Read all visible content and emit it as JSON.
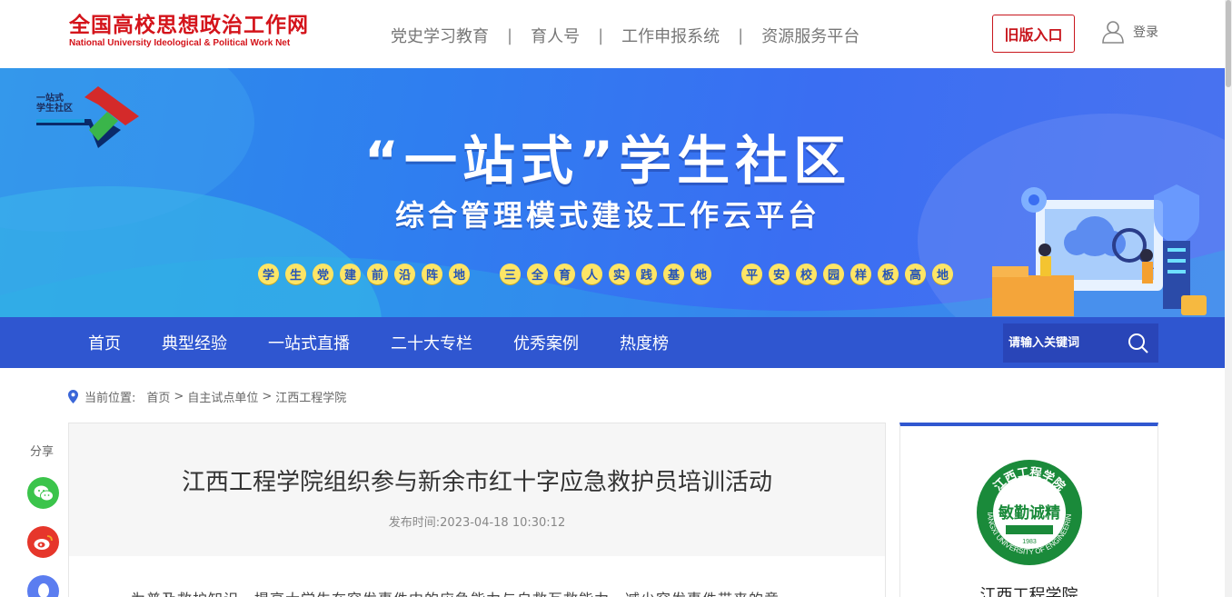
{
  "header": {
    "logo_cn": "全国高校思想政治工作网",
    "logo_en": "National University Ideological & Political Work Net",
    "nav": [
      "党史学习教育",
      "育人号",
      "工作申报系统",
      "资源服务平台"
    ],
    "nav_sep": "|",
    "old_entry": "旧版入口",
    "login": "登录"
  },
  "banner": {
    "logo_text_line1": "一站式",
    "logo_text_line2": "学生社区",
    "title": "“一站式”学生社区",
    "subtitle": "综合管理模式建设工作云平台",
    "groups": [
      [
        "学",
        "生",
        "党",
        "建",
        "前",
        "沿",
        "阵",
        "地"
      ],
      [
        "三",
        "全",
        "育",
        "人",
        "实",
        "践",
        "基",
        "地"
      ],
      [
        "平",
        "安",
        "校",
        "园",
        "样",
        "板",
        "高",
        "地"
      ]
    ]
  },
  "main_nav": {
    "items": [
      "首页",
      "典型经验",
      "一站式直播",
      "二十大专栏",
      "优秀案例",
      "热度榜"
    ],
    "search_placeholder": "请输入关键词"
  },
  "breadcrumb": {
    "label": "当前位置:",
    "items": [
      "首页",
      "自主试点单位",
      "江西工程学院"
    ],
    "sep": ">"
  },
  "share": {
    "label": "分享",
    "icons": [
      "wechat-icon",
      "weibo-icon",
      "qq-icon"
    ],
    "colors": [
      "#3bc44b",
      "#e6362b",
      "#5b7df0"
    ]
  },
  "article": {
    "title": "江西工程学院组织参与新余市红十字应急救护员培训活动",
    "date_label": "发布时间:",
    "date": "2023-04-18 10:30:12",
    "first_para": "为普及救护知识，提高大学生在突发事件中的应急能力与自救互救能力，减少突发事件带来的意"
  },
  "side": {
    "emblem_text_top": "江西工程学院",
    "emblem_text_en": "JIANGXI UNIVERSITY OF ENGINEERING",
    "emblem_year": "1983",
    "emblem_motto": "敏勤诚精",
    "university": "江西工程学院"
  },
  "colors": {
    "brand_red": "#d4141b",
    "nav_blue": "#2f56d0",
    "banner_blue": "#2f7ef0",
    "badge_yellow": "#fde566",
    "emblem_green": "#1a8a3a"
  }
}
